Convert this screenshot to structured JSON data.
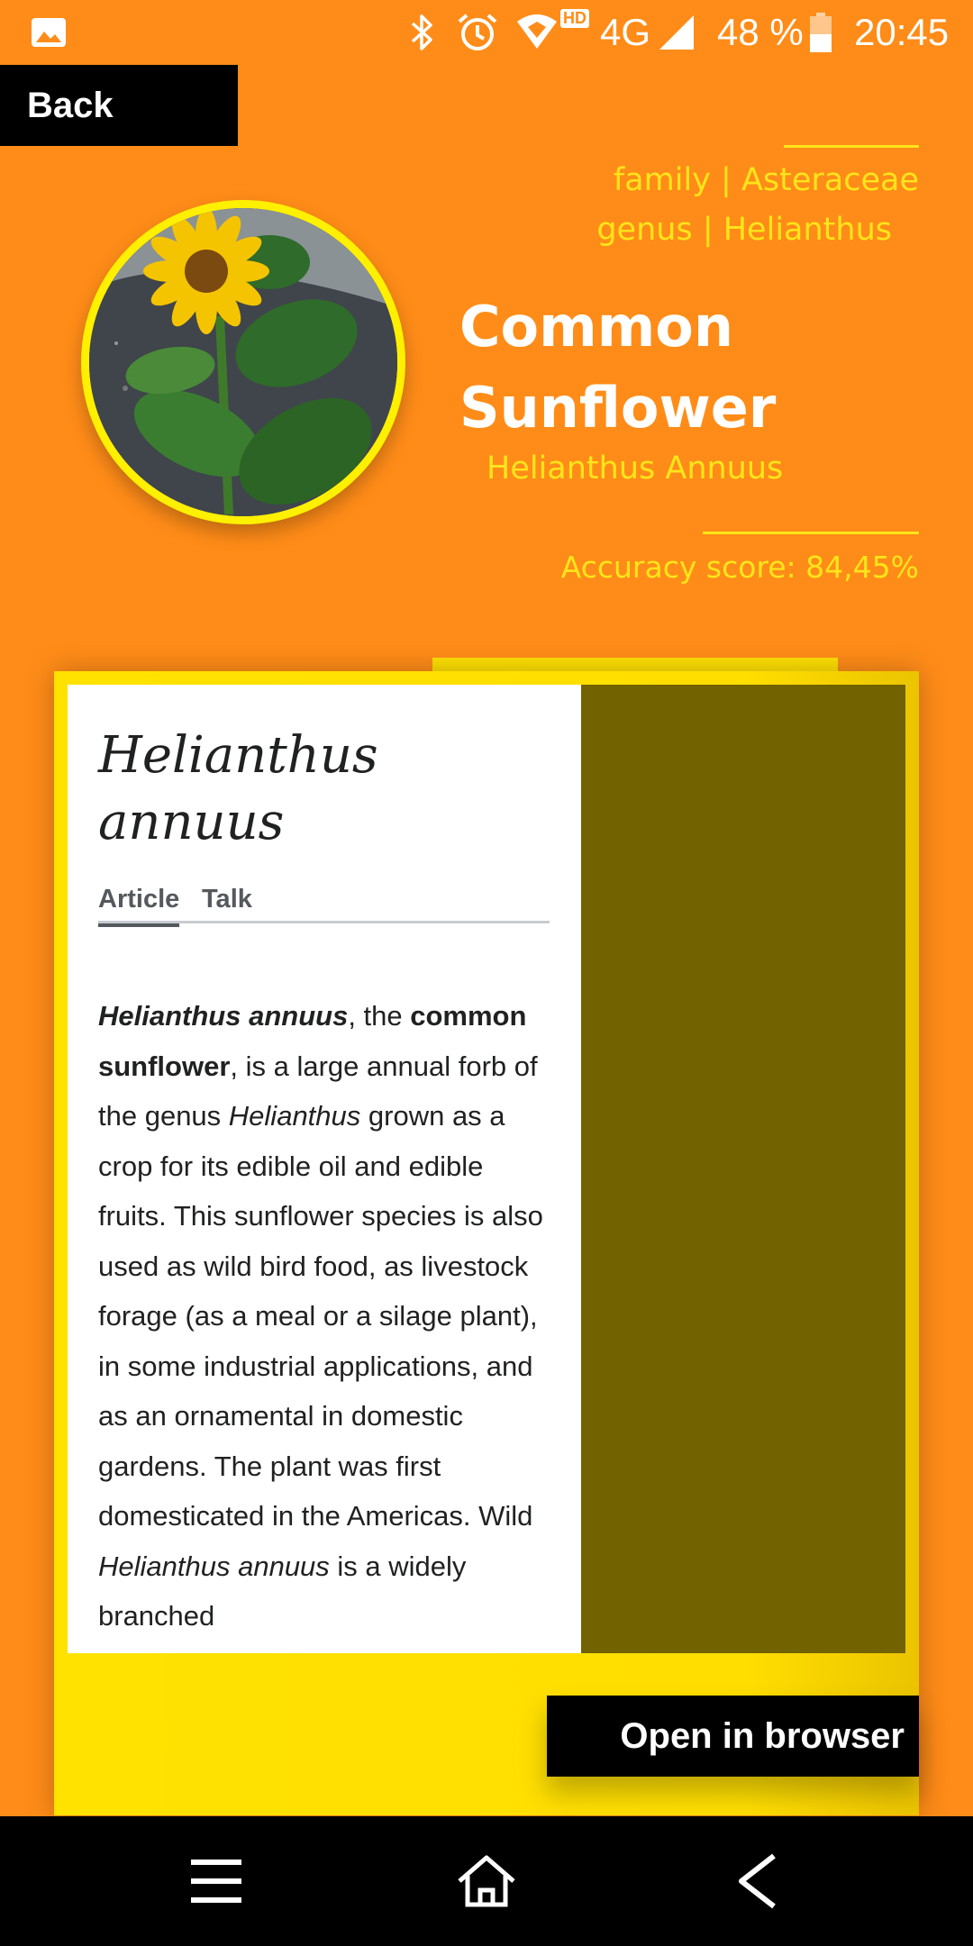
{
  "status_bar": {
    "battery": "48 %",
    "time": "20:45",
    "network": "4G",
    "hd": "HD",
    "icons": [
      "gallery-icon",
      "bluetooth-icon",
      "alarm-icon",
      "wifi-icon",
      "signal-icon",
      "battery-icon"
    ]
  },
  "header": {
    "back_label": "Back",
    "family_line": "family | Asteraceae",
    "genus_line": "genus | Helianthus",
    "common_name": "Common Sunflower",
    "scientific_name": "Helianthus Annuus",
    "accuracy": "Accuracy score: 84,45%"
  },
  "article": {
    "title": "Helianthus annuus",
    "tabs": [
      "Article",
      "Talk"
    ],
    "active_tab": "Article",
    "body": {
      "b1": "Helianthus annuus",
      "t1": ", the ",
      "b2": "common sunflower",
      "t2": ", is a large annual forb of the genus ",
      "i1": "Helianthus",
      "t3": " grown as a crop for its edible oil and edible fruits. This sunflower species is also used as wild bird food, as livestock forage (as a meal or a silage plant), in some industrial applications, and as an ornamental in domestic gardens. The plant was first domesticated in the Americas. Wild ",
      "i2": "Helianthus annuus",
      "t4": " is a widely branched"
    }
  },
  "actions": {
    "open_in_browser": "Open in browser"
  },
  "navigation": {
    "icons": [
      "menu-icon",
      "home-icon",
      "back-arrow-icon"
    ]
  },
  "colors": {
    "background": "#FF8C18",
    "accent_yellow": "#FFE51A",
    "card_yellow": "#FFE000",
    "webview_dark": "#726200",
    "button_black": "#000000"
  }
}
